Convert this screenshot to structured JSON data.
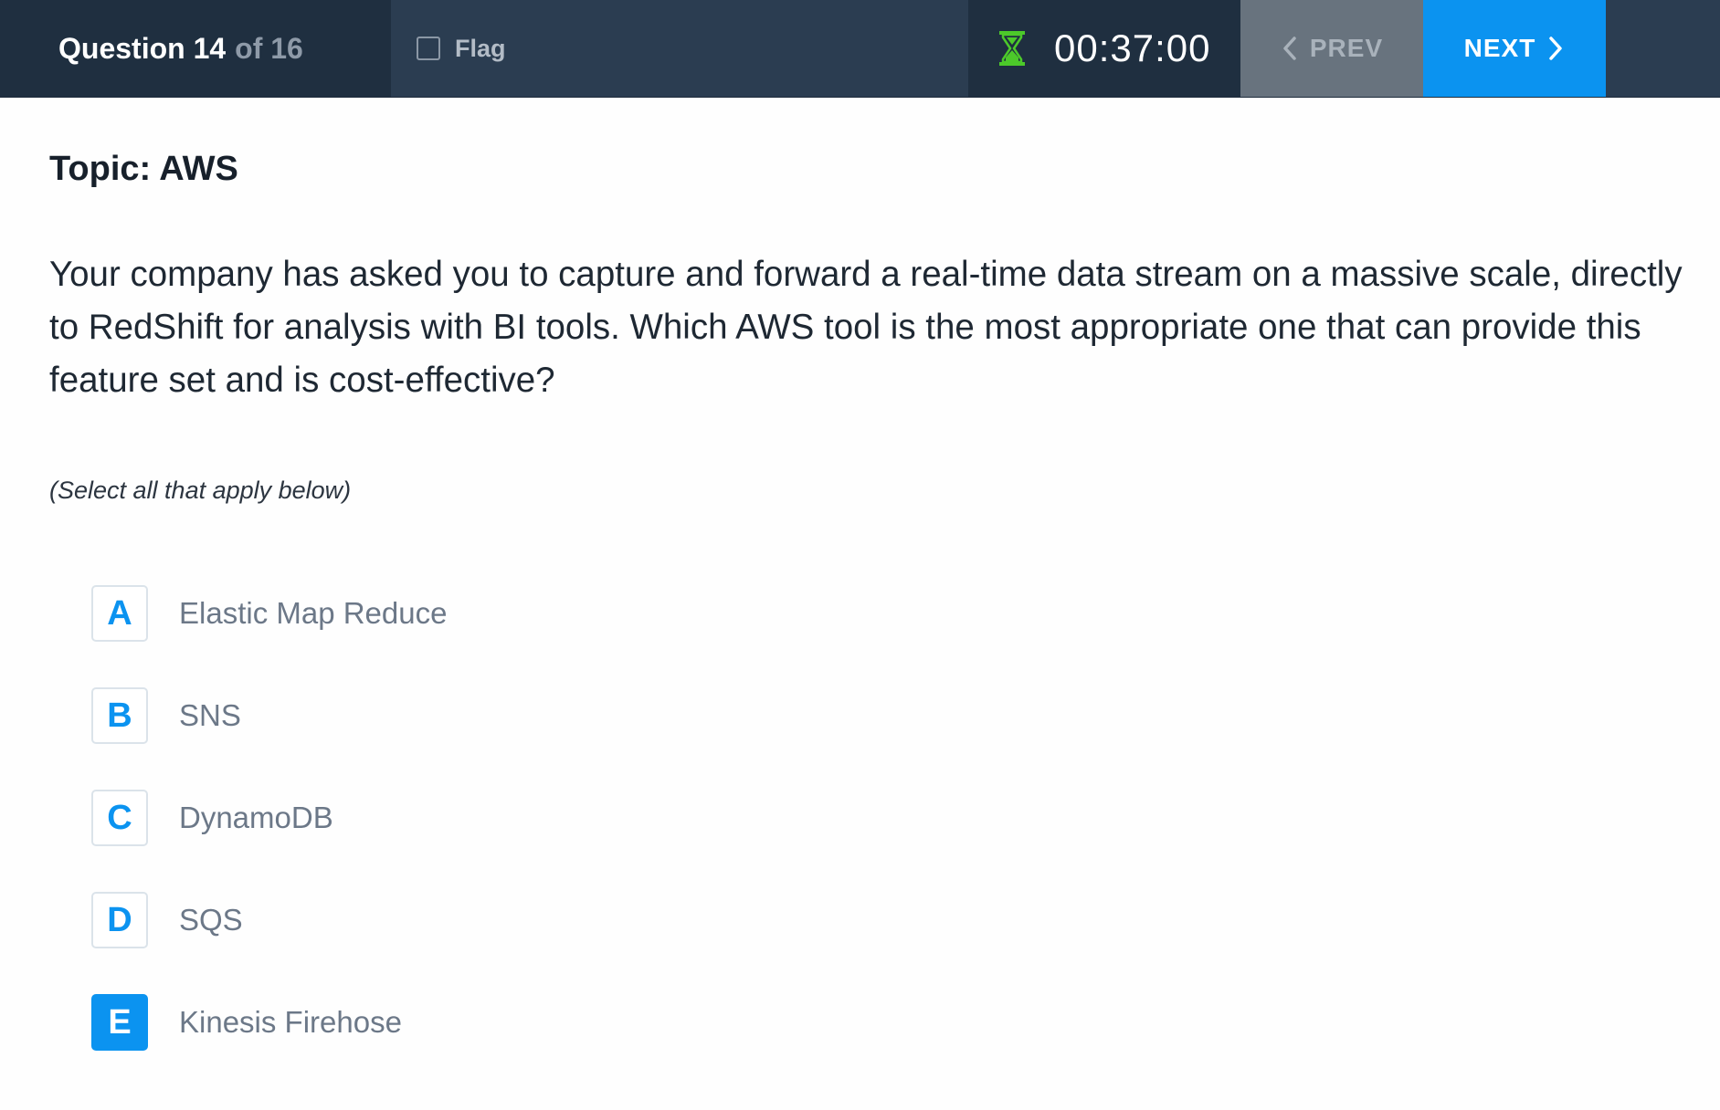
{
  "header": {
    "question_label": "Question 14",
    "question_total": "of 16",
    "flag_label": "Flag",
    "flag_checked": false,
    "timer_icon": "hourglass-icon",
    "timer_value": "00:37:00",
    "prev_label": "PREV",
    "next_label": "NEXT"
  },
  "content": {
    "topic": "Topic: AWS",
    "question": "Your company has asked you to capture and forward a real-time data stream on a massive scale, directly to RedShift for analysis with BI tools. Which AWS tool is the most appropriate one that can provide this feature set and is cost-effective?",
    "instruction": "(Select all that apply below)"
  },
  "answers": [
    {
      "letter": "A",
      "label": "Elastic Map Reduce",
      "selected": false
    },
    {
      "letter": "B",
      "label": "SNS",
      "selected": false
    },
    {
      "letter": "C",
      "label": "DynamoDB",
      "selected": false
    },
    {
      "letter": "D",
      "label": "SQS",
      "selected": false
    },
    {
      "letter": "E",
      "label": "Kinesis Firehose",
      "selected": true
    }
  ],
  "colors": {
    "accent": "#0b93f0",
    "topbar": "#2b3d51",
    "timer_icon": "#4cc92a",
    "prev_button": "#68737e"
  }
}
